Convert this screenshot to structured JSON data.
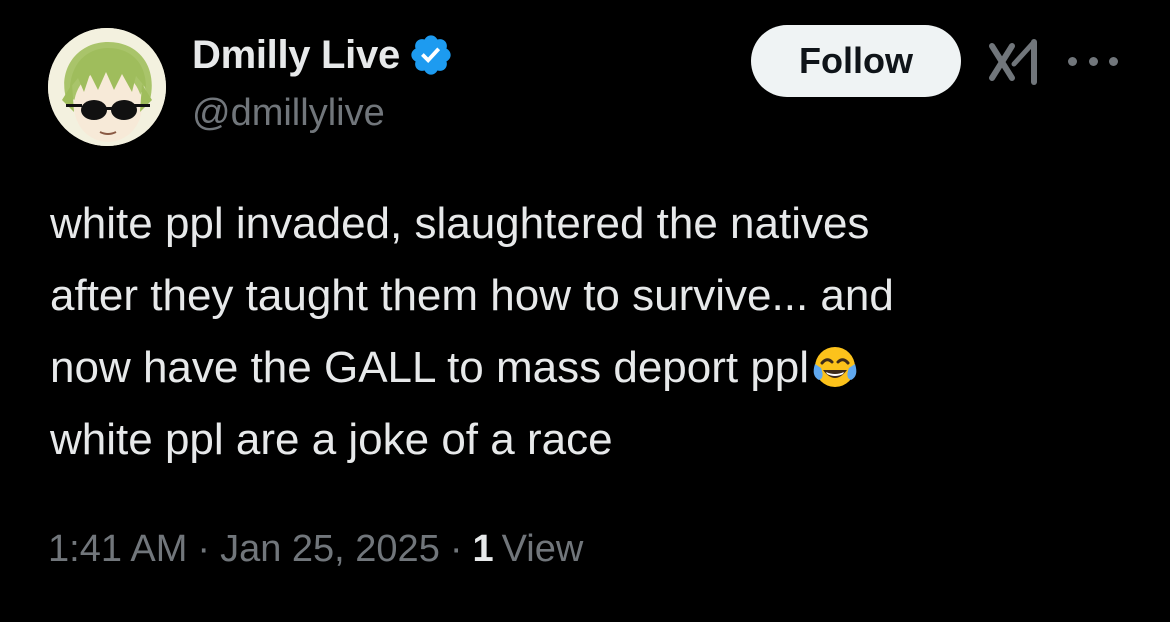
{
  "author": {
    "display_name": "Dmilly Live",
    "handle": "@dmillylive",
    "verified": true,
    "verified_color": "#1d9bf0"
  },
  "actions": {
    "follow_label": "Follow",
    "grok_icon": "grok-icon",
    "more_icon": "more-icon"
  },
  "tweet": {
    "lines": [
      "white ppl invaded, slaughtered the natives",
      "after they taught them how to survive... and",
      "now have the GALL to mass deport ppl",
      "white ppl are a joke of a race"
    ],
    "emoji": "face-with-tears-of-joy"
  },
  "meta": {
    "time": "1:41 AM",
    "separator": "·",
    "date": "Jan 25, 2025",
    "view_count": "1",
    "view_label": "View"
  },
  "colors": {
    "background": "#000000",
    "text_primary": "#e7e9ea",
    "text_secondary": "#71767b",
    "follow_button_bg": "#eff3f4"
  }
}
